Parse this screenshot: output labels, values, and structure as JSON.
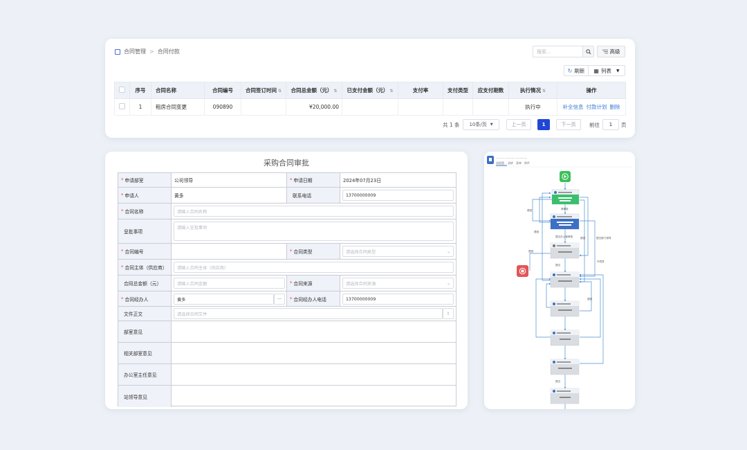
{
  "list": {
    "breadcrumb": [
      "合同管理",
      "合同付款"
    ],
    "breadcrumb_sep": ">",
    "search_placeholder": "搜索...",
    "advanced_label": "高级",
    "refresh_label": "刷新",
    "view_label": "列表",
    "columns": [
      "序号",
      "合同名称",
      "合同编号",
      "合同签订时间",
      "合同总金额（元）",
      "已支付金额（元）",
      "支付率",
      "支付类型",
      "应支付期数",
      "执行情况",
      "操作"
    ],
    "rows": [
      {
        "index": "1",
        "name": "租房合同变更",
        "number": "090890",
        "sign_date": "",
        "total": "¥20,000.00",
        "paid": "",
        "rate": "",
        "pay_type": "",
        "periods": "",
        "status": "执行中",
        "ops": [
          "补全信息",
          "付款计划",
          "删除"
        ]
      }
    ],
    "pagination": {
      "total_text": "共 1 条",
      "page_size": "10条/页",
      "prev": "上一页",
      "current": "1",
      "next": "下一页",
      "goto_label": "前往",
      "goto_value": "1",
      "page_unit": "页"
    }
  },
  "form": {
    "title": "采购合同审批",
    "fields": {
      "dept_label": "申请部室",
      "dept_value": "公司领导",
      "date_label": "申请日期",
      "date_value": "2024年07月23日",
      "applicant_label": "申请人",
      "applicant_value": "黄多",
      "phone_label": "联系电话",
      "phone_value": "13700000009",
      "name_label": "合同名称",
      "name_placeholder": "请输入合同名称",
      "matter_label": "呈批事项",
      "matter_placeholder": "请输入呈批事项",
      "number_label": "合同编号",
      "type_label": "合同类型",
      "type_placeholder": "请选择合同类型",
      "party_label": "合同主体（供应商）",
      "party_placeholder": "请输入合同主体（供应商）",
      "amount_label": "合同总金额（元）",
      "amount_placeholder": "请输入合同金额",
      "source_label": "合同来源",
      "source_placeholder": "请选择合同来源",
      "handler_label": "合同经办人",
      "handler_value": "黄多",
      "handler_more": "···",
      "handler_phone_label": "合同经办人电话",
      "handler_phone_value": "13700000009",
      "doc_label": "文件正文",
      "doc_placeholder": "请选择合同文件",
      "opinion_dept": "部室意见",
      "opinion_related": "相关部室意见",
      "opinion_office": "办公室主任意见",
      "opinion_leader": "站领导意见"
    }
  },
  "flow": {
    "tabs": [
      "流程图",
      "流转",
      "表单",
      "附件"
    ],
    "edge_labels": [
      "退回",
      "请审批",
      "退回",
      "提交办公室审批",
      "退回",
      "退回",
      "提交部门领导",
      "提交",
      "不同意",
      "退回",
      "提交"
    ],
    "colors": {
      "start": "#3cbf5a",
      "end": "#e25555",
      "active": "#3cbf6d",
      "done": "#3d6fc4",
      "pending": "#d9dce1",
      "edge": "#4d8fd1"
    }
  }
}
